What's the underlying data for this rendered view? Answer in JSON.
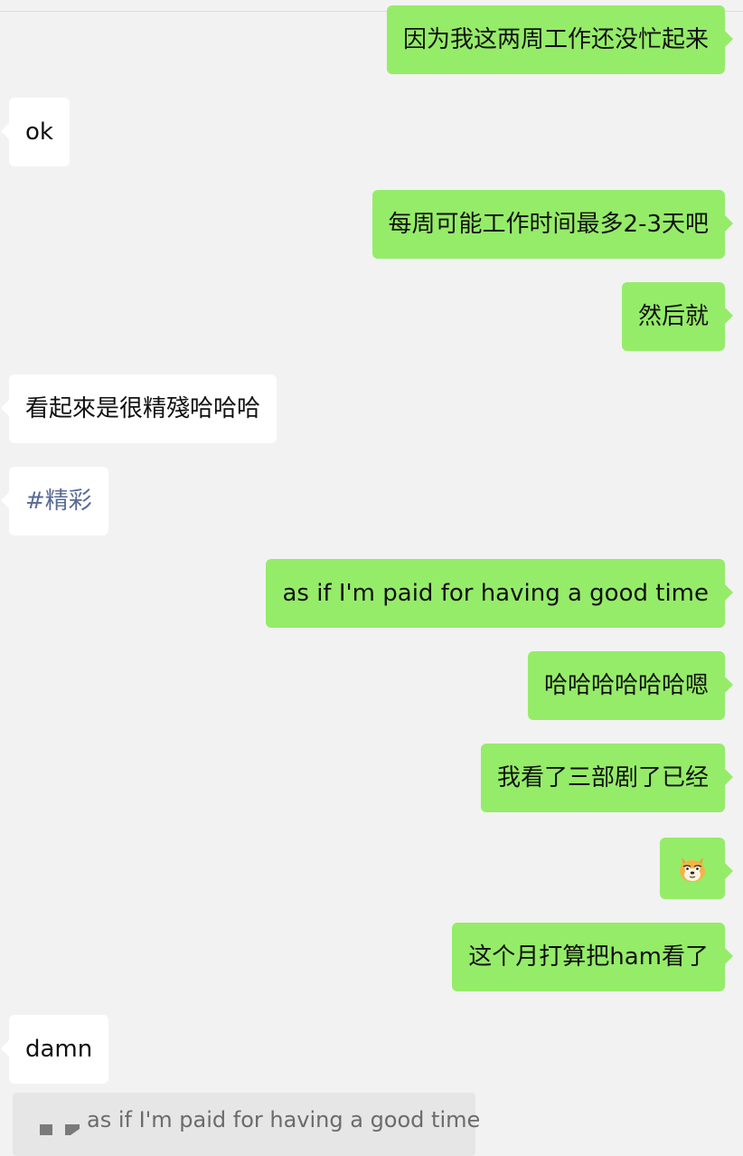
{
  "messages": [
    {
      "direction": "out",
      "text": "因为我这两周工作还没忙起来"
    },
    {
      "direction": "in",
      "text": "ok"
    },
    {
      "direction": "out",
      "text": "每周可能工作时间最多2-3天吧"
    },
    {
      "direction": "out",
      "text": "然后就"
    },
    {
      "direction": "in",
      "text": "看起來是很精殘哈哈哈"
    },
    {
      "direction": "in",
      "text": "#精彩"
    },
    {
      "direction": "out",
      "text": "as if I'm paid for having a good time"
    },
    {
      "direction": "out",
      "text": "哈哈哈哈哈哈嗯"
    },
    {
      "direction": "out",
      "text": "我看了三部剧了已经"
    },
    {
      "direction": "out",
      "text": "",
      "sticker": "doge-emoji-icon"
    },
    {
      "direction": "out",
      "text": "这个月打算把ham看了"
    },
    {
      "direction": "in",
      "text": "damn"
    }
  ],
  "quoted_reply": {
    "text": "as if I'm paid for having a good time"
  },
  "colors": {
    "background": "#f2f2f2",
    "outgoing_bubble": "#95ec69",
    "incoming_bubble": "#ffffff",
    "hashtag": "#576b95",
    "quote_background": "#e6e6e6"
  }
}
